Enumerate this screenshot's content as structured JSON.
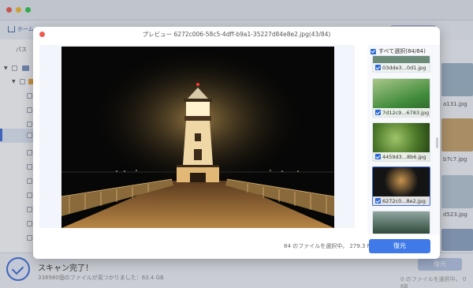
{
  "background": {
    "nav": {
      "home_label": "ホーム"
    },
    "path_label": "パス",
    "right_thumb_labels": [
      "a131.jpg",
      "b7c7.jpg",
      "d523.jpg"
    ],
    "footer": {
      "scan_title": "スキャン完了！",
      "scan_subtitle": "338980個のファイルが見つかりました：63.4 GB",
      "recover_label": "復元",
      "selected_count": "0 のファイルを選択中。 0 KB"
    }
  },
  "modal": {
    "title": "プレビュー 6272c006-58c5-4dff-b9a1-35227d84e8e2.jpg(43/84)",
    "select_all_label": "すべて選択(84/84)",
    "thumbnails": [
      {
        "label": "03dde3...0d1.jpg",
        "color": "#6b8a78",
        "active": false
      },
      {
        "label": "7d12c9...6783.jpg",
        "color": "#3f8a3a",
        "active": false
      },
      {
        "label": "4459d3...8b6.jpg",
        "color": "#4e7a2a",
        "active": false
      },
      {
        "label": "6272c0...8e2.jpg",
        "color": "#141414",
        "active": true
      },
      {
        "label": "",
        "color": "#2f4a3a",
        "active": false
      }
    ],
    "status_text": "84 のファイルを選択中。 279.3 MB",
    "recover_button": "復元"
  },
  "colors": {
    "accent": "#3f7ae8",
    "close_dot": "#ee5a52"
  }
}
